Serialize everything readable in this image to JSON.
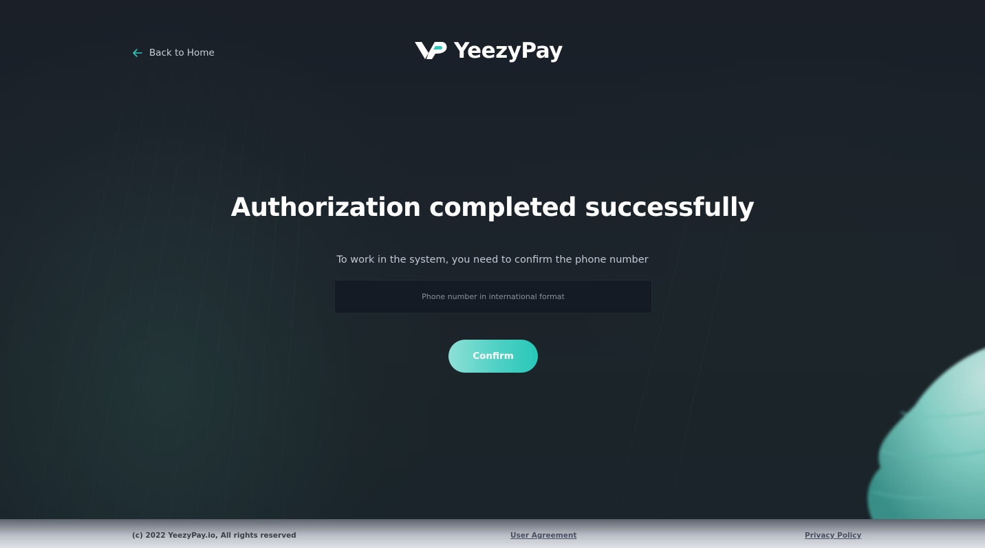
{
  "header": {
    "back_label": "Back to Home",
    "logo_text": "YeezyPay"
  },
  "main": {
    "title": "Authorization completed successfully",
    "subtitle": "To work in the system, you need to confirm the phone number",
    "phone_placeholder": "Phone number in international format",
    "phone_value": "",
    "confirm_label": "Confirm"
  },
  "footer": {
    "copyright": "(c) 2022 YeezyPay.io, All rights reserved",
    "user_agreement": "User Agreement",
    "privacy_policy": "Privacy Policy"
  },
  "icons": {
    "back": "arrow-left-icon",
    "logo": "yeezypay-logo-mark"
  },
  "colors": {
    "accent": "#2fc8b9",
    "accent_light": "#8ee0d6",
    "background": "#1a1f27",
    "input_bg": "#151b25"
  }
}
